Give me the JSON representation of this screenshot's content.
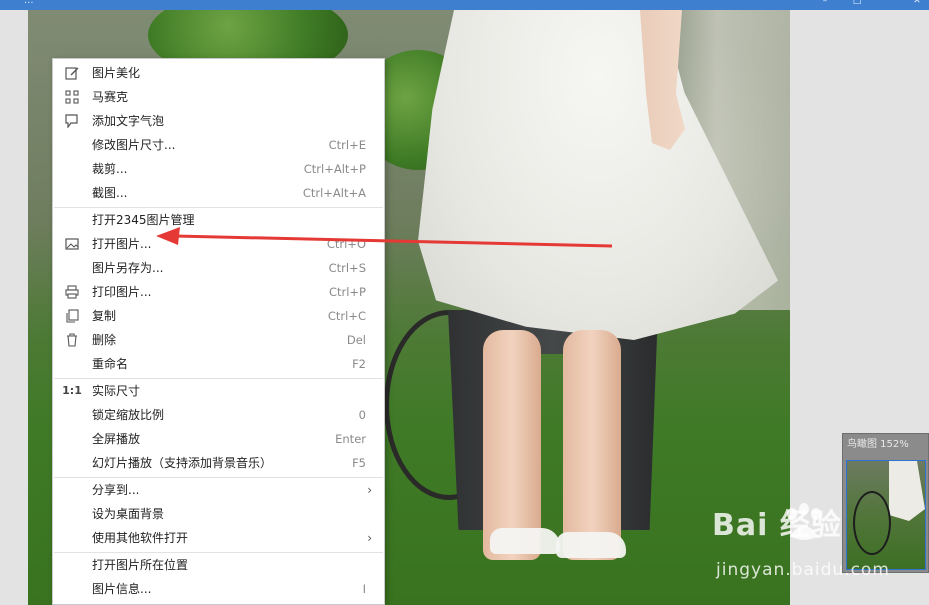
{
  "titlebar": {
    "title": "...",
    "accent_color": "#3f7fd0"
  },
  "context_menu": {
    "items": [
      {
        "label": "图片美化",
        "shortcut": "",
        "icon": "edit-pencil-icon"
      },
      {
        "label": "马赛克",
        "shortcut": "",
        "icon": "mosaic-icon"
      },
      {
        "label": "添加文字气泡",
        "shortcut": "",
        "icon": "text-bubble-icon"
      },
      {
        "label": "修改图片尺寸...",
        "shortcut": "Ctrl+E",
        "icon": ""
      },
      {
        "label": "裁剪...",
        "shortcut": "Ctrl+Alt+P",
        "icon": ""
      },
      {
        "label": "截图...",
        "shortcut": "Ctrl+Alt+A",
        "icon": ""
      },
      {
        "label": "打开2345图片管理",
        "shortcut": "",
        "icon": ""
      },
      {
        "label": "打开图片...",
        "shortcut": "Ctrl+O",
        "icon": "image-icon"
      },
      {
        "label": "图片另存为...",
        "shortcut": "Ctrl+S",
        "icon": ""
      },
      {
        "label": "打印图片...",
        "shortcut": "Ctrl+P",
        "icon": "printer-icon"
      },
      {
        "label": "复制",
        "shortcut": "Ctrl+C",
        "icon": "copy-icon"
      },
      {
        "label": "删除",
        "shortcut": "Del",
        "icon": "trash-icon"
      },
      {
        "label": "重命名",
        "shortcut": "F2",
        "icon": ""
      },
      {
        "label": "实际尺寸",
        "shortcut": "",
        "icon": "actual-size-icon",
        "icon_text": "1:1"
      },
      {
        "label": "锁定缩放比例",
        "shortcut": "0",
        "icon": ""
      },
      {
        "label": "全屏播放",
        "shortcut": "Enter",
        "icon": ""
      },
      {
        "label": "幻灯片播放（支持添加背景音乐）",
        "shortcut": "F5",
        "icon": ""
      },
      {
        "label": "分享到...",
        "shortcut": "",
        "icon": "",
        "submenu": true
      },
      {
        "label": "设为桌面背景",
        "shortcut": "",
        "icon": ""
      },
      {
        "label": "使用其他软件打开",
        "shortcut": "",
        "icon": "",
        "submenu": true
      },
      {
        "label": "打开图片所在位置",
        "shortcut": "",
        "icon": ""
      },
      {
        "label": "图片信息...",
        "shortcut": "I",
        "icon": ""
      }
    ],
    "submenu_arrow": "›"
  },
  "navigator": {
    "title": "鸟瞰图 152%",
    "frame_color": "#2e73d1"
  },
  "watermark": {
    "logo": "Bai  经验",
    "url": "jingyan.baidu.com"
  },
  "annotation": {
    "color": "#e53935"
  }
}
